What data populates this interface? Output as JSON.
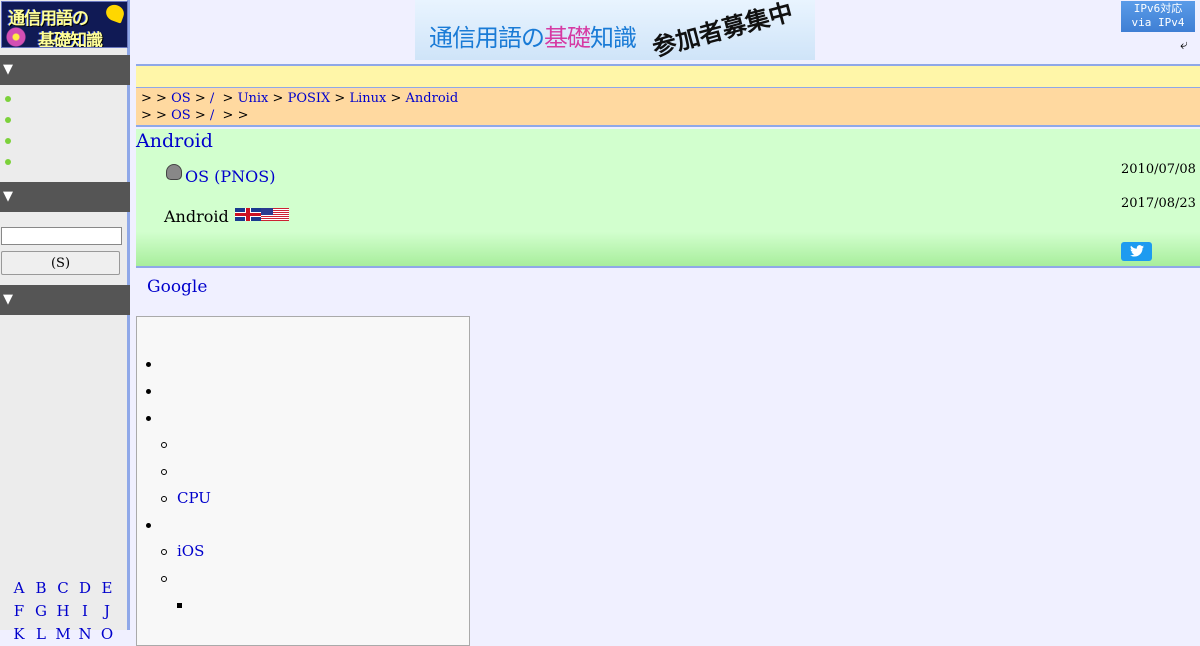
{
  "header": {
    "logo": {
      "line1": "通信用語の",
      "line2": "基礎知識"
    },
    "banner": {
      "text_a": "通信",
      "text_b": "用語の",
      "text_c": "基礎",
      "text_d": "知識",
      "text_e": "参加者募集中"
    },
    "ipv6_badge": {
      "line1": "IPv6対応",
      "line2": "via IPv4"
    },
    "return_icon": "return-arrow-icon"
  },
  "sidebar": {
    "section_toggle": "▼",
    "search_button_label": "(S)",
    "search_input_value": "",
    "alphabet_rows": [
      [
        "A",
        "B",
        "C",
        "D",
        "E"
      ],
      [
        "F",
        "G",
        "H",
        "I",
        "J"
      ],
      [
        "K",
        "L",
        "M",
        "N",
        "O"
      ]
    ]
  },
  "breadcrumb": {
    "row1": {
      "sep": ">",
      "items": [
        "OS",
        "/",
        "Unix",
        "POSIX",
        "Linux",
        "Android"
      ]
    },
    "row2": {
      "sep": ">",
      "items": [
        "OS",
        "/"
      ]
    }
  },
  "entry": {
    "title": "Android",
    "category_link": "OS (PNOS)",
    "category_date": "2010/07/08",
    "term": "Android",
    "term_date": "2017/08/23",
    "share_icon": "twitter-bird-icon",
    "google_text": "Google"
  },
  "toc": {
    "items": [
      "CPU",
      "iOS"
    ]
  }
}
